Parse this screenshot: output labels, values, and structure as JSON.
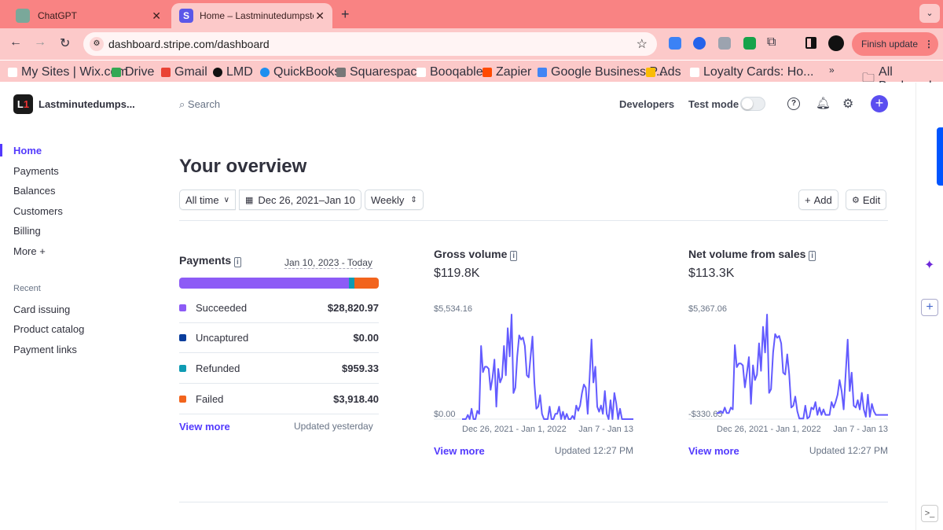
{
  "browser": {
    "tabs": [
      {
        "title": "ChatGPT",
        "icon": "chatgpt-icon"
      },
      {
        "title": "Home – Lastminutedumpster",
        "icon": "stripe-icon"
      }
    ],
    "url": "dashboard.stripe.com/dashboard",
    "finish_update": "Finish update",
    "bookmarks": [
      "My Sites | Wix.com",
      "Drive",
      "Gmail",
      "LMD",
      "QuickBooks",
      "Squarespace",
      "Booqable",
      "Zapier",
      "Google Business P...",
      "Ads",
      "Loyalty Cards: Ho..."
    ],
    "all_bookmarks": "All Bookmarks",
    "theme_color": "#f98383"
  },
  "header": {
    "account": "Lastminutedumps...",
    "search_placeholder": "Search",
    "developers": "Developers",
    "test_mode": "Test mode",
    "test_mode_on": false
  },
  "sidebar": {
    "items": [
      "Home",
      "Payments",
      "Balances",
      "Customers",
      "Billing",
      "More +"
    ],
    "active": "Home",
    "recent_label": "Recent",
    "recent": [
      "Card issuing",
      "Product catalog",
      "Payment links"
    ]
  },
  "main": {
    "title": "Your overview",
    "filters": {
      "range": "All time",
      "dates": "Dec 26, 2021–Jan 10",
      "interval": "Weekly"
    },
    "add": "Add",
    "edit": "Edit",
    "payments": {
      "title": "Payments",
      "period": "Jan 10, 2023 - Today",
      "rows": [
        {
          "label": "Succeeded",
          "value": "$28,820.97",
          "color": "#8d5bf6"
        },
        {
          "label": "Uncaptured",
          "value": "$0.00",
          "color": "#0a3d9c"
        },
        {
          "label": "Refunded",
          "value": "$959.33",
          "color": "#0f9bb3"
        },
        {
          "label": "Failed",
          "value": "$3,918.40",
          "color": "#f2641d"
        }
      ],
      "view_more": "View more",
      "updated": "Updated yesterday"
    },
    "accent": "#533afd"
  },
  "chart_data": [
    {
      "type": "line",
      "title": "Gross volume",
      "total": "$119.8K",
      "ymax_label": "$5,534.16",
      "ymin_label": "$0.00",
      "ylim": [
        0,
        5534.16
      ],
      "xticks": [
        "Dec 26, 2021 - Jan 1, 2022",
        "Jan 7 - Jan 13"
      ],
      "color": "#635bff",
      "view_more": "View more",
      "updated": "Updated 12:27 PM",
      "values": [
        0,
        0,
        0,
        220,
        0,
        550,
        0,
        0,
        440,
        280,
        3870,
        2490,
        2770,
        2770,
        2660,
        1550,
        2210,
        3150,
        660,
        2660,
        1940,
        2210,
        3870,
        2320,
        4810,
        3320,
        5534.16,
        1380,
        1660,
        3320,
        4430,
        4210,
        4320,
        3870,
        2320,
        2210,
        3320,
        4370,
        1940,
        550,
        660,
        1270,
        280,
        0,
        0,
        0,
        660,
        0,
        0,
        280,
        280,
        660,
        0,
        390,
        0,
        280,
        0,
        0,
        170,
        0,
        720,
        440,
        720,
        1380,
        1830,
        1660,
        280,
        2210,
        4210,
        1940,
        2770,
        660,
        390,
        720,
        280,
        1490,
        280,
        0,
        1000,
        0,
        1380,
        830,
        0,
        550,
        0,
        0,
        0,
        0,
        0,
        0,
        0
      ]
    },
    {
      "type": "line",
      "title": "Net volume from sales",
      "total": "$113.3K",
      "ymax_label": "$5,367.06",
      "ymin_label": "-$330.65",
      "ylim": [
        -330.65,
        5367.06
      ],
      "xticks": [
        "Dec 26, 2021 - Jan 1, 2022",
        "Jan 7 - Jan 13"
      ],
      "color": "#635bff",
      "view_more": "View more",
      "updated": "Updated 12:27 PM",
      "values": [
        0,
        0,
        100,
        0,
        300,
        0,
        0,
        300,
        200,
        3700,
        2500,
        2700,
        2700,
        2600,
        1400,
        2200,
        3050,
        500,
        2600,
        1800,
        2100,
        3800,
        2300,
        4700,
        3300,
        5367.06,
        1100,
        1300,
        3300,
        4300,
        4100,
        4200,
        3800,
        2200,
        2100,
        3200,
        2100,
        300,
        400,
        900,
        100,
        -300,
        -300,
        -300,
        400,
        -300,
        -200,
        300,
        200,
        600,
        -100,
        300,
        -100,
        200,
        -100,
        -100,
        -100,
        600,
        300,
        600,
        1000,
        1800,
        1200,
        200,
        2100,
        4000,
        1200,
        2200,
        400,
        300,
        700,
        200,
        1100,
        200,
        -200,
        1000,
        -200,
        500,
        100,
        -100,
        -100,
        -100,
        -100,
        -100,
        -100,
        -100
      ]
    }
  ]
}
